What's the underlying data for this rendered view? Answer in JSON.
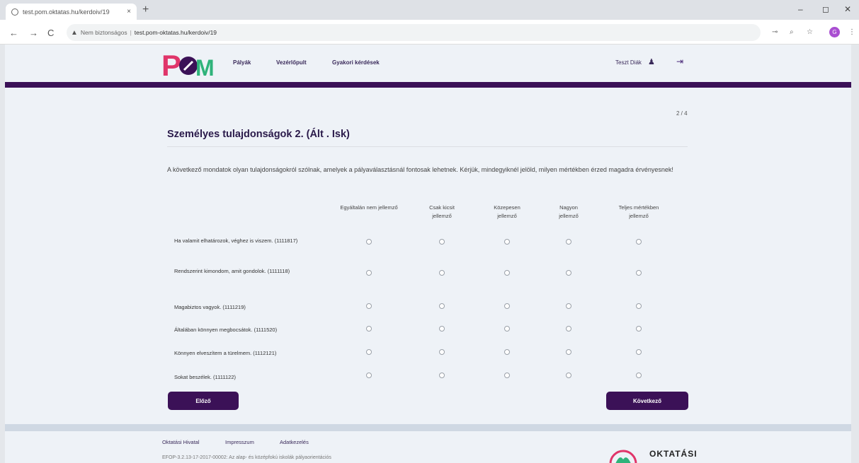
{
  "browser": {
    "tab_title": "test.pom.oktatas.hu/kerdoiv/19",
    "tab_close": "×",
    "new_tab": "+",
    "window_controls": [
      "–",
      "◻",
      "✕"
    ],
    "nav": {
      "back": "←",
      "forward": "→",
      "reload": "C"
    },
    "security_warning": "Nem biztonságos",
    "url": "test.pom-oktatas.hu/kerdoiv/19",
    "profile_initial": "G"
  },
  "header": {
    "logo_text": "POM",
    "nav": [
      "Pályák",
      "Vezérlőpult",
      "Gyakori kérdések"
    ],
    "user_name": "Teszt Diák",
    "user_icon": "person-icon",
    "logout_icon": "logout-icon"
  },
  "survey": {
    "pager": "2 / 4",
    "title": "Személyes tulajdonságok 2. (Ált . Isk)",
    "intro": "A következő mondatok olyan tulajdonságokról szólnak, amelyek a pályaválasztásnál fontosak lehetnek. Kérjük, mindegyiknél jelöld, milyen mértékben érzed magadra érvényesnek!",
    "columns": [
      "Egyáltalán nem jellemző",
      "Csak kicsit jellemző",
      "Közepesen jellemző",
      "Nagyon jellemző",
      "Teljes mértékben jellemző"
    ],
    "rows": [
      "Ha valamit elhatározok, véghez is viszem. (1111817)",
      "Rendszerint kimondom, amit gondolok. (1111118)",
      "Magabiztos vagyok. (1111219)",
      "Általában könnyen megbocsátok. (1111520)",
      "Könnyen elveszítem a türelmem. (1112121)",
      "Sokat beszélek. (1111122)"
    ],
    "back_button": "Előző",
    "next_button": "Következő"
  },
  "footer": {
    "links": [
      "Oktatási Hivatal",
      "Impresszum",
      "Adatkezelés"
    ],
    "note": "EFOP-3.2.13-17-2017-00002: Az alap- és középfokú iskolák pályaorientációs",
    "logo_text": "OKTATÁSI"
  },
  "colors": {
    "brand_purple": "#3b1157",
    "accent_pink": "#e0356a",
    "accent_green": "#2fb37a"
  }
}
